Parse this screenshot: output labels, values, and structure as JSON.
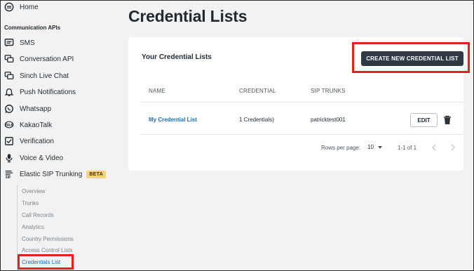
{
  "sidebar": {
    "home_label": "Home",
    "section_title": "Communication APIs",
    "items": [
      {
        "label": "SMS",
        "icon": "sms-icon"
      },
      {
        "label": "Conversation API",
        "icon": "conversation-icon"
      },
      {
        "label": "Sinch Live Chat",
        "icon": "chat-icon"
      },
      {
        "label": "Push Notifications",
        "icon": "bell-icon"
      },
      {
        "label": "Whatsapp",
        "icon": "whatsapp-icon"
      },
      {
        "label": "KakaoTalk",
        "icon": "kakaotalk-icon"
      },
      {
        "label": "Verification",
        "icon": "checkbox-icon"
      },
      {
        "label": "Voice & Video",
        "icon": "voice-icon"
      },
      {
        "label": "Elastic SIP Trunking",
        "icon": "sip-icon",
        "badge": "BETA"
      }
    ],
    "subitems": [
      {
        "label": "Overview"
      },
      {
        "label": "Trunks"
      },
      {
        "label": "Call Records"
      },
      {
        "label": "Analytics"
      },
      {
        "label": "Country Permissions"
      },
      {
        "label": "Access Control Lists"
      },
      {
        "label": "Credentials List",
        "active": true
      }
    ]
  },
  "main": {
    "title": "Credential Lists",
    "card": {
      "title": "Your Credential Lists",
      "create_button": "CREATE NEW CREDENTIAL LIST",
      "columns": [
        "NAME",
        "CREDENTIAL",
        "SIP TRUNKS"
      ],
      "rows": [
        {
          "name": "My Credential List",
          "credential": "1 Credentials)",
          "sip_trunks": "patricktest001",
          "edit_label": "EDIT"
        }
      ],
      "pagination": {
        "rows_per_page_label": "Rows per page:",
        "rows_per_page_value": "10",
        "range": "1-1 of 1"
      }
    }
  },
  "colors": {
    "accent_link": "#1a6fb0",
    "primary_button": "#2f3a44",
    "highlight_box": "#e0241b",
    "beta_badge": "#f9d27d"
  }
}
